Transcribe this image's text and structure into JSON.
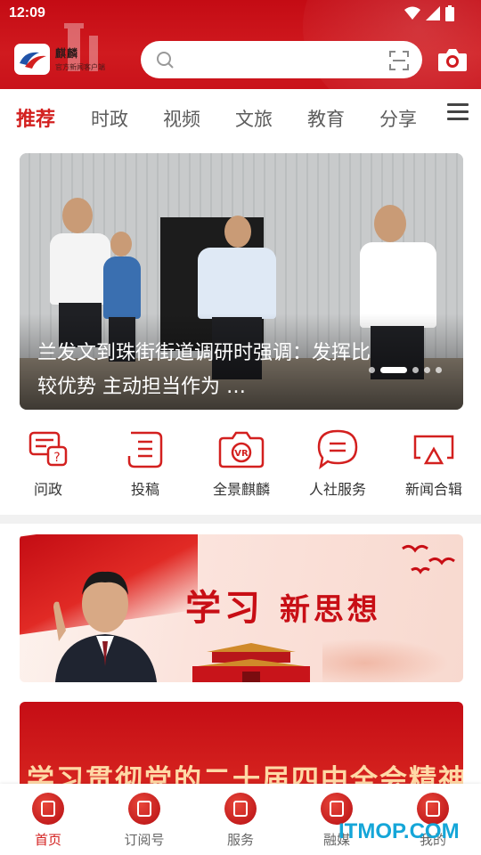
{
  "status": {
    "time": "12:09"
  },
  "header": {
    "logo_text": "麒麟",
    "logo_sub": "官方新闻客户端",
    "search_placeholder": ""
  },
  "tabs": [
    {
      "label": "推荐",
      "active": true
    },
    {
      "label": "时政"
    },
    {
      "label": "视频"
    },
    {
      "label": "文旅"
    },
    {
      "label": "教育"
    },
    {
      "label": "分享"
    }
  ],
  "hero": {
    "caption": "兰发文到珠街街道调研时强调：发挥比较优势 主动担当作为 …",
    "slide_index": 2,
    "slide_count": 5
  },
  "quick_links": [
    {
      "label": "问政",
      "icon": "question-chat-icon"
    },
    {
      "label": "投稿",
      "icon": "document-icon"
    },
    {
      "label": "全景麒麟",
      "icon": "vr-camera-icon"
    },
    {
      "label": "人社服务",
      "icon": "chat-lines-icon"
    },
    {
      "label": "新闻合辑",
      "icon": "screen-cast-icon"
    }
  ],
  "banner": {
    "title_a": "学习",
    "title_b": "新思想"
  },
  "banner2": {
    "text": "学习贯彻党的二十届四中全会精神"
  },
  "bottom_nav": [
    {
      "label": "首页",
      "active": true
    },
    {
      "label": "订阅号"
    },
    {
      "label": "服务"
    },
    {
      "label": "融媒"
    },
    {
      "label": "我的"
    }
  ],
  "watermark": "ITMOP.COM",
  "colors": {
    "brand": "#d3201f",
    "header_bg": "#c9121a"
  }
}
